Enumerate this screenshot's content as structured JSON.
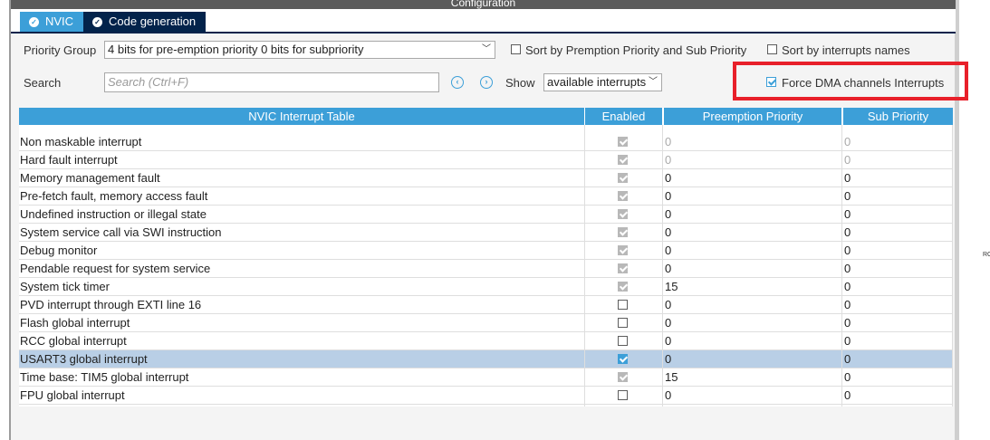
{
  "window": {
    "title": "Configuration"
  },
  "tabs": [
    {
      "label": "NVIC"
    },
    {
      "label": "Code generation"
    }
  ],
  "toolbar": {
    "priority_group_label": "Priority Group",
    "priority_group_value": "4 bits for pre-emption priority 0 bits for subpriority",
    "sort_premption_label": "Sort by Premption Priority and Sub Priority",
    "sort_premption_checked": false,
    "sort_names_label": "Sort by interrupts names",
    "sort_names_checked": false,
    "search_label": "Search",
    "search_placeholder": "Search (Ctrl+F)",
    "show_label": "Show",
    "show_value": "available interrupts",
    "force_dma_label": "Force DMA channels Interrupts",
    "force_dma_checked": true
  },
  "table": {
    "headers": [
      "NVIC Interrupt Table",
      "Enabled",
      "Preemption Priority",
      "Sub Priority"
    ],
    "rows": [
      {
        "name": "Non maskable interrupt",
        "enabled": true,
        "locked": true,
        "preemption": "0",
        "sub": "0",
        "dim": true
      },
      {
        "name": "Hard fault interrupt",
        "enabled": true,
        "locked": true,
        "preemption": "0",
        "sub": "0",
        "dim": true
      },
      {
        "name": "Memory management fault",
        "enabled": true,
        "locked": true,
        "preemption": "0",
        "sub": "0",
        "dim": false
      },
      {
        "name": "Pre-fetch fault, memory access fault",
        "enabled": true,
        "locked": true,
        "preemption": "0",
        "sub": "0",
        "dim": false
      },
      {
        "name": "Undefined instruction or illegal state",
        "enabled": true,
        "locked": true,
        "preemption": "0",
        "sub": "0",
        "dim": false
      },
      {
        "name": "System service call via SWI instruction",
        "enabled": true,
        "locked": true,
        "preemption": "0",
        "sub": "0",
        "dim": false
      },
      {
        "name": "Debug monitor",
        "enabled": true,
        "locked": true,
        "preemption": "0",
        "sub": "0",
        "dim": false
      },
      {
        "name": "Pendable request for system service",
        "enabled": true,
        "locked": true,
        "preemption": "0",
        "sub": "0",
        "dim": false
      },
      {
        "name": "System tick timer",
        "enabled": true,
        "locked": true,
        "preemption": "15",
        "sub": "0",
        "dim": false
      },
      {
        "name": "PVD interrupt through EXTI line 16",
        "enabled": false,
        "locked": false,
        "preemption": "0",
        "sub": "0",
        "dim": false
      },
      {
        "name": "Flash global interrupt",
        "enabled": false,
        "locked": false,
        "preemption": "0",
        "sub": "0",
        "dim": false
      },
      {
        "name": "RCC global interrupt",
        "enabled": false,
        "locked": false,
        "preemption": "0",
        "sub": "0",
        "dim": false
      },
      {
        "name": "USART3 global interrupt",
        "enabled": true,
        "locked": false,
        "preemption": "0",
        "sub": "0",
        "dim": false,
        "selected": true
      },
      {
        "name": "Time base: TIM5 global interrupt",
        "enabled": true,
        "locked": true,
        "preemption": "15",
        "sub": "0",
        "dim": false
      },
      {
        "name": "FPU global interrupt",
        "enabled": false,
        "locked": false,
        "preemption": "0",
        "sub": "0",
        "dim": false
      }
    ]
  },
  "side_fragment": "RC",
  "colors": {
    "accent": "#3c9fd8",
    "tab_active": "#03234b",
    "highlight": "#e8202a",
    "selected_row": "#b9cfe6"
  },
  "icons": {
    "tab": "check-circle-icon",
    "prev": "chevron-left-circle-icon",
    "next": "chevron-right-circle-icon"
  }
}
